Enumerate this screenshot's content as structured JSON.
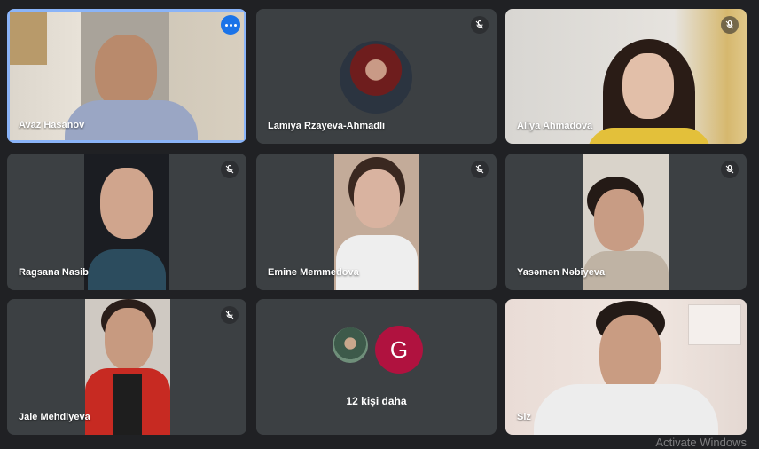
{
  "participants": [
    {
      "name": "Avaz Hasanov"
    },
    {
      "name": "Lamiya Rzayeva-Ahmadli"
    },
    {
      "name": "Aliya Ahmadova"
    },
    {
      "name": "Ragsana Nasib"
    },
    {
      "name": "Emine Memmedova"
    },
    {
      "name": "Yasəmən Nəbiyeva"
    },
    {
      "name": "Jale Mehdiyeva"
    },
    {
      "name": "Siz"
    }
  ],
  "overflow": {
    "avatar_letter": "G",
    "label": "12 kişi daha"
  },
  "watermark": "Activate Windows",
  "colors": {
    "background": "#202124",
    "tile": "#3c4043",
    "active_border": "#8ab4f8",
    "avatar_g": "#b0123f"
  },
  "icons": {
    "mute": "mic-off-icon",
    "more": "more-options-icon"
  }
}
